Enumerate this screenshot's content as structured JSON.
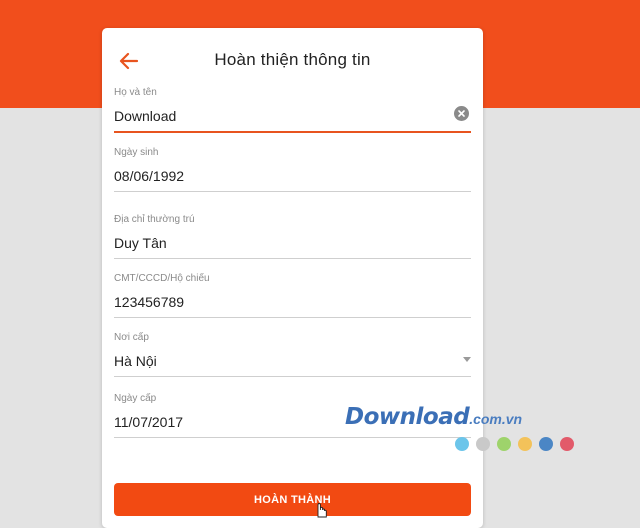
{
  "form": {
    "title": "Hoàn thiện thông tin",
    "fields": [
      {
        "label": "Họ và tên",
        "value": "Download"
      },
      {
        "label": "Ngày sinh",
        "value": "08/06/1992"
      },
      {
        "label": "Địa chỉ thường trú",
        "value": "Duy Tân"
      },
      {
        "label": "CMT/CCCD/Hộ chiếu",
        "value": "123456789"
      },
      {
        "label": "Nơi cấp",
        "value": "Hà Nội"
      },
      {
        "label": "Ngày cấp",
        "value": "11/07/2017"
      }
    ],
    "submit_label": "HOÀN THÀNH"
  },
  "watermark": {
    "text": "Download",
    "suffix": ".com.vn",
    "dot_colors": [
      "#6cc5ea",
      "#c9c9c9",
      "#9ed36b",
      "#f3c25a",
      "#4b86c5",
      "#e25a6a"
    ]
  },
  "colors": {
    "accent": "#f14e1c",
    "button": "#f24a12",
    "background": "#e3e3e3"
  }
}
